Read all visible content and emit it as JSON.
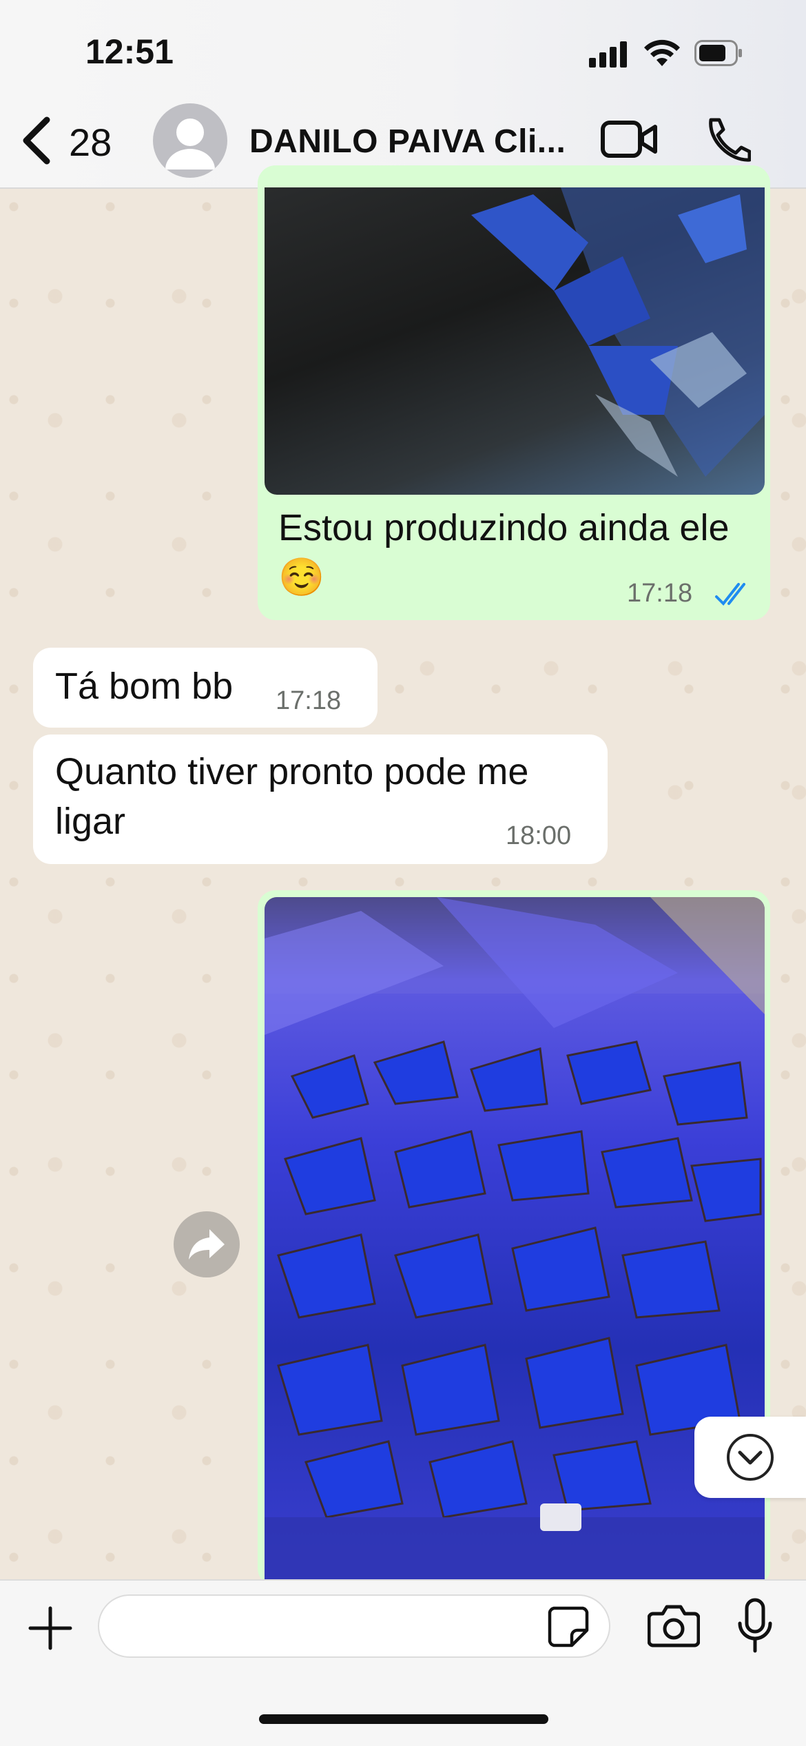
{
  "status_bar": {
    "time": "12:51"
  },
  "header": {
    "back_count": "28",
    "contact_name": "DANILO PAIVA Cli...",
    "icons": [
      "chevron-left-icon",
      "avatar-icon",
      "video-camera-icon",
      "phone-icon"
    ]
  },
  "messages": [
    {
      "direction": "outgoing",
      "type": "image-caption",
      "text": "Estou produzindo ainda ele ☺️",
      "time": "17:18",
      "status": "read"
    },
    {
      "direction": "incoming",
      "type": "text",
      "text": "Tá bom bb",
      "time": "17:18"
    },
    {
      "direction": "incoming",
      "type": "text",
      "text": "Quanto tiver pronto pode me ligar",
      "time": "18:00"
    },
    {
      "direction": "outgoing",
      "type": "image"
    }
  ],
  "input": {
    "value": "",
    "placeholder": ""
  },
  "colors": {
    "outgoing_bubble": "#d9fdd3",
    "incoming_bubble": "#ffffff",
    "read_ticks": "#1f8cf0",
    "wallpaper": "#efe7dc"
  }
}
